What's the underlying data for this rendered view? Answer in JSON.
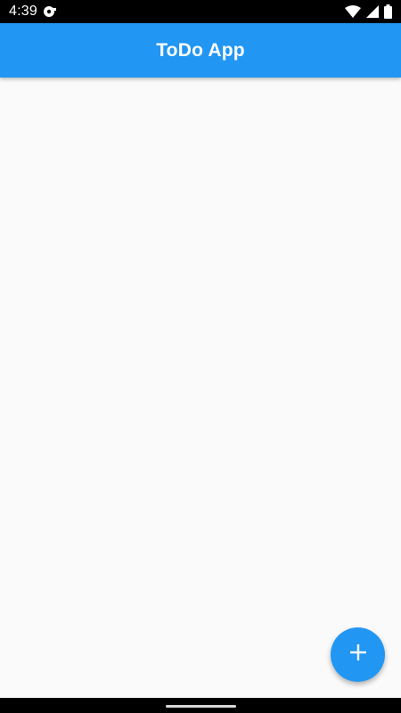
{
  "status_bar": {
    "time": "4:39",
    "icons": [
      "notification-icon",
      "wifi-icon",
      "signal-icon",
      "battery-icon"
    ]
  },
  "app_bar": {
    "title": "ToDo App",
    "color": "#2196f3"
  },
  "fab": {
    "icon": "plus-icon",
    "color": "#2196f3"
  },
  "content": {
    "background": "#fafafa"
  }
}
